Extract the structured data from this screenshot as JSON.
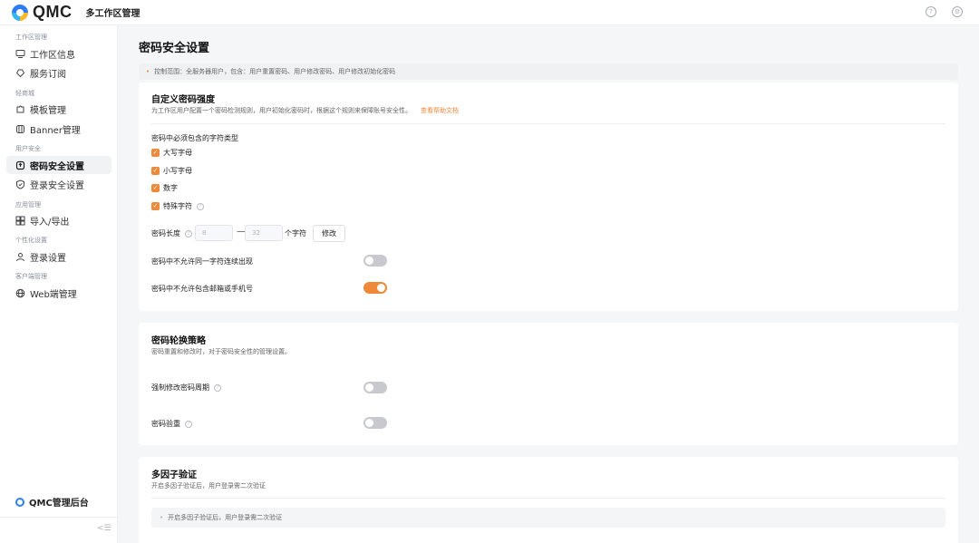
{
  "header": {
    "logo_text": "QMC",
    "app_title": "多工作区管理",
    "help_icon": "help-circle-icon",
    "settings_icon": "gear-icon"
  },
  "sidebar": {
    "groups": [
      {
        "label": "工作区管理",
        "items": [
          {
            "label": "工作区信息",
            "icon": "monitor-icon"
          },
          {
            "label": "服务订阅",
            "icon": "shield-heart-icon"
          }
        ]
      },
      {
        "label": "轻商城",
        "items": [
          {
            "label": "模板管理",
            "icon": "puzzle-icon"
          },
          {
            "label": "Banner管理",
            "icon": "banner-icon"
          }
        ]
      },
      {
        "label": "用户安全",
        "items": [
          {
            "label": "密码安全设置",
            "icon": "lock-icon",
            "active": true
          },
          {
            "label": "登录安全设置",
            "icon": "shield-check-icon"
          }
        ]
      },
      {
        "label": "应用管理",
        "items": [
          {
            "label": "导入/导出",
            "icon": "grid-icon"
          }
        ]
      },
      {
        "label": "个性化设置",
        "items": [
          {
            "label": "登录设置",
            "icon": "user-icon"
          }
        ]
      },
      {
        "label": "客户端管理",
        "items": [
          {
            "label": "Web端管理",
            "icon": "globe-icon"
          }
        ]
      }
    ],
    "footer_label": "QMC管理后台"
  },
  "main": {
    "page_title": "密码安全设置",
    "notice": "控制范围：全服务器用户，包含：用户重置密码、用户修改密码、用户修改初始化密码",
    "strength": {
      "title": "自定义密码强度",
      "desc": "为工作区用户配置一个密码检测规则，用户初始化密码时，根据这个规则来保障账号安全性。",
      "help_link": "查看帮助文档",
      "char_types_label": "密码中必须包含的字符类型",
      "char_types": [
        {
          "label": "大写字母",
          "checked": true
        },
        {
          "label": "小写字母",
          "checked": true
        },
        {
          "label": "数字",
          "checked": true
        },
        {
          "label": "特殊字符",
          "checked": true
        }
      ],
      "length_label": "密码长度",
      "min_length_placeholder": "8",
      "max_length_placeholder": "32",
      "length_unit": "个字符",
      "modify_button": "修改",
      "no_repeat_label": "密码中不允许同一字符连续出现",
      "no_repeat_on": false,
      "no_contact_label": "密码中不允许包含邮箱或手机号",
      "no_contact_on": true
    },
    "rotation": {
      "title": "密码轮换策略",
      "desc": "密码重置和修改时，对于密码安全性的管理设置。",
      "force_period_label": "强制修改密码周期",
      "force_period_on": false,
      "verify_label": "密码验重",
      "verify_on": false
    },
    "mfa": {
      "title": "多因子验证",
      "desc": "开启多因子验证后，用户登录需二次验证",
      "note": "开启多因子验证后，用户登录需二次验证"
    }
  }
}
